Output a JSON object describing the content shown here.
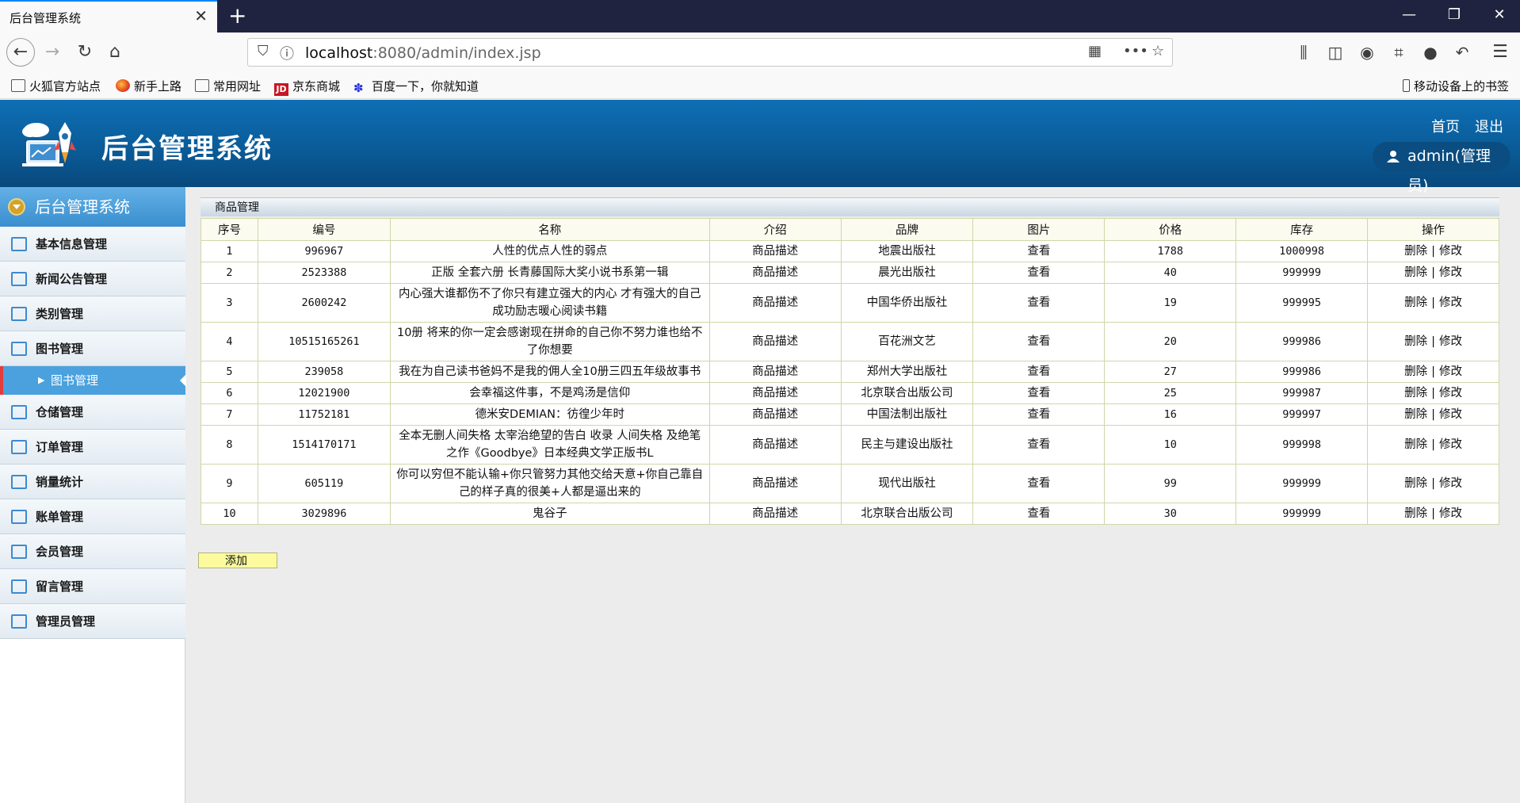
{
  "browser": {
    "tab_title": "后台管理系统",
    "url_host": "localhost",
    "url_rest": ":8080/admin/index.jsp",
    "bookmarks": [
      "火狐官方站点",
      "新手上路",
      "常用网址",
      "京东商城",
      "百度一下，你就知道"
    ],
    "mobile_bookmarks": "移动设备上的书签"
  },
  "header": {
    "title": "后台管理系统",
    "home": "首页",
    "logout": "退出",
    "user": "admin(管理员)"
  },
  "sidebar": {
    "title": "后台管理系统",
    "items": [
      {
        "label": "基本信息管理",
        "icon": "list-icon"
      },
      {
        "label": "新闻公告管理",
        "icon": "monitor-icon"
      },
      {
        "label": "类别管理",
        "icon": "edit-icon"
      },
      {
        "label": "图书管理",
        "icon": "book-icon"
      },
      {
        "label": "仓储管理",
        "icon": "warehouse-icon"
      },
      {
        "label": "订单管理",
        "icon": "calendar-icon"
      },
      {
        "label": "销量统计",
        "icon": "bar-chart-icon"
      },
      {
        "label": "账单管理",
        "icon": "document-icon"
      },
      {
        "label": "会员管理",
        "icon": "users-icon"
      },
      {
        "label": "留言管理",
        "icon": "chat-icon"
      },
      {
        "label": "管理员管理",
        "icon": "admin-icon"
      }
    ],
    "active_sub": "图书管理"
  },
  "panel": {
    "title": "商品管理",
    "columns": [
      "序号",
      "编号",
      "名称",
      "介绍",
      "品牌",
      "图片",
      "价格",
      "库存",
      "操作"
    ],
    "rows": [
      {
        "idx": "1",
        "code": "996967",
        "name": "人性的优点人性的弱点",
        "intro": "商品描述",
        "brand": "地震出版社",
        "pic": "查看",
        "price": "1788",
        "stock": "1000998"
      },
      {
        "idx": "2",
        "code": "2523388",
        "name": "正版 全套六册 长青藤国际大奖小说书系第一辑",
        "intro": "商品描述",
        "brand": "晨光出版社",
        "pic": "查看",
        "price": "40",
        "stock": "999999"
      },
      {
        "idx": "3",
        "code": "2600242",
        "name": "内心强大谁都伤不了你只有建立强大的内心 才有强大的自己 成功励志暖心阅读书籍",
        "intro": "商品描述",
        "brand": "中国华侨出版社",
        "pic": "查看",
        "price": "19",
        "stock": "999995"
      },
      {
        "idx": "4",
        "code": "10515165261",
        "name": "10册 将来的你一定会感谢现在拼命的自己你不努力谁也给不了你想要",
        "intro": "商品描述",
        "brand": "百花洲文艺",
        "pic": "查看",
        "price": "20",
        "stock": "999986"
      },
      {
        "idx": "5",
        "code": "239058",
        "name": "我在为自己读书爸妈不是我的佣人全10册三四五年级故事书",
        "intro": "商品描述",
        "brand": "郑州大学出版社",
        "pic": "查看",
        "price": "27",
        "stock": "999986"
      },
      {
        "idx": "6",
        "code": "12021900",
        "name": "会幸福这件事，不是鸡汤是信仰",
        "intro": "商品描述",
        "brand": "北京联合出版公司",
        "pic": "查看",
        "price": "25",
        "stock": "999987"
      },
      {
        "idx": "7",
        "code": "11752181",
        "name": "德米安DEMIAN：彷徨少年时",
        "intro": "商品描述",
        "brand": "中国法制出版社",
        "pic": "查看",
        "price": "16",
        "stock": "999997"
      },
      {
        "idx": "8",
        "code": "1514170171",
        "name": "全本无删人间失格 太宰治绝望的告白 收录 人间失格 及绝笔之作《Goodbye》日本经典文学正版书L",
        "intro": "商品描述",
        "brand": "民主与建设出版社",
        "pic": "查看",
        "price": "10",
        "stock": "999998"
      },
      {
        "idx": "9",
        "code": "605119",
        "name": "你可以穷但不能认输+你只管努力其他交给天意+你自己靠自己的样子真的很美+人都是逼出来的",
        "intro": "商品描述",
        "brand": "现代出版社",
        "pic": "查看",
        "price": "99",
        "stock": "999999"
      },
      {
        "idx": "10",
        "code": "3029896",
        "name": "鬼谷子",
        "intro": "商品描述",
        "brand": "北京联合出版公司",
        "pic": "查看",
        "price": "30",
        "stock": "999999"
      }
    ],
    "op_delete": "删除",
    "op_separator": "|",
    "op_edit": "修改",
    "add_label": "添加"
  }
}
